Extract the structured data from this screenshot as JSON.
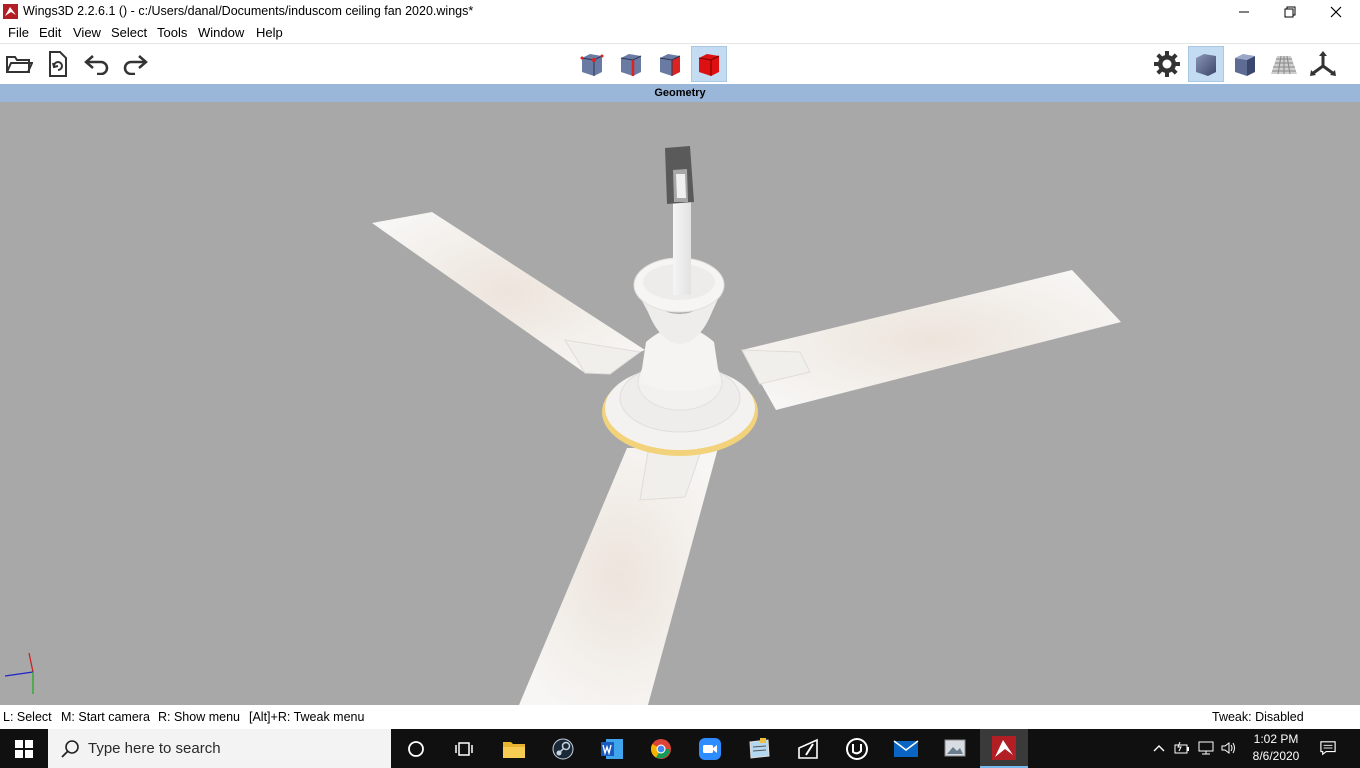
{
  "window": {
    "title": "Wings3D 2.2.6.1 () - c:/Users/danal/Documents/induscom ceiling fan 2020.wings*",
    "controls": [
      "minimize-icon",
      "restore-icon",
      "close-icon"
    ]
  },
  "menubar": {
    "items": [
      {
        "label": "File"
      },
      {
        "label": "Edit"
      },
      {
        "label": "View"
      },
      {
        "label": "Select"
      },
      {
        "label": "Tools"
      },
      {
        "label": "Window"
      },
      {
        "label": "Help"
      }
    ]
  },
  "toolbar": {
    "left": [
      "open-folder-icon",
      "import-icon",
      "undo-icon",
      "redo-icon"
    ],
    "selection_modes": [
      "vertex-mode-icon",
      "edge-mode-icon",
      "face-mode-icon",
      "body-mode-icon"
    ],
    "active_selection_mode": "body-mode-icon",
    "right": [
      "preferences-gear-icon",
      "smooth-shaded-view-icon",
      "flat-shaded-view-icon",
      "ground-grid-icon",
      "axes-icon"
    ]
  },
  "viewport": {
    "header": "Geometry",
    "background_color": "#a8a8a8"
  },
  "statusbar": {
    "left_hints": [
      "L: Select",
      "M: Start camera",
      "R: Show menu",
      "[Alt]+R: Tweak menu"
    ],
    "tweak_status": "Tweak: Disabled"
  },
  "taskbar": {
    "search_placeholder": "Type here to search",
    "apps": [
      "cortana-icon",
      "task-view-icon",
      "file-explorer-icon",
      "steam-icon",
      "word-icon",
      "chrome-icon",
      "zoom-icon",
      "notepad-icon",
      "paint-icon",
      "unreal-engine-icon",
      "mail-icon",
      "photo-viewer-icon",
      "wings3d-icon"
    ],
    "time": "1:02 PM",
    "date": "8/6/2020"
  },
  "colors": {
    "selection_active": "#c4dcf2",
    "geometry_bar": "#9ab6d8",
    "taskbar": "#101010",
    "fan_blade": "#f3f0ec",
    "selection_outline": "#f2d27a"
  }
}
